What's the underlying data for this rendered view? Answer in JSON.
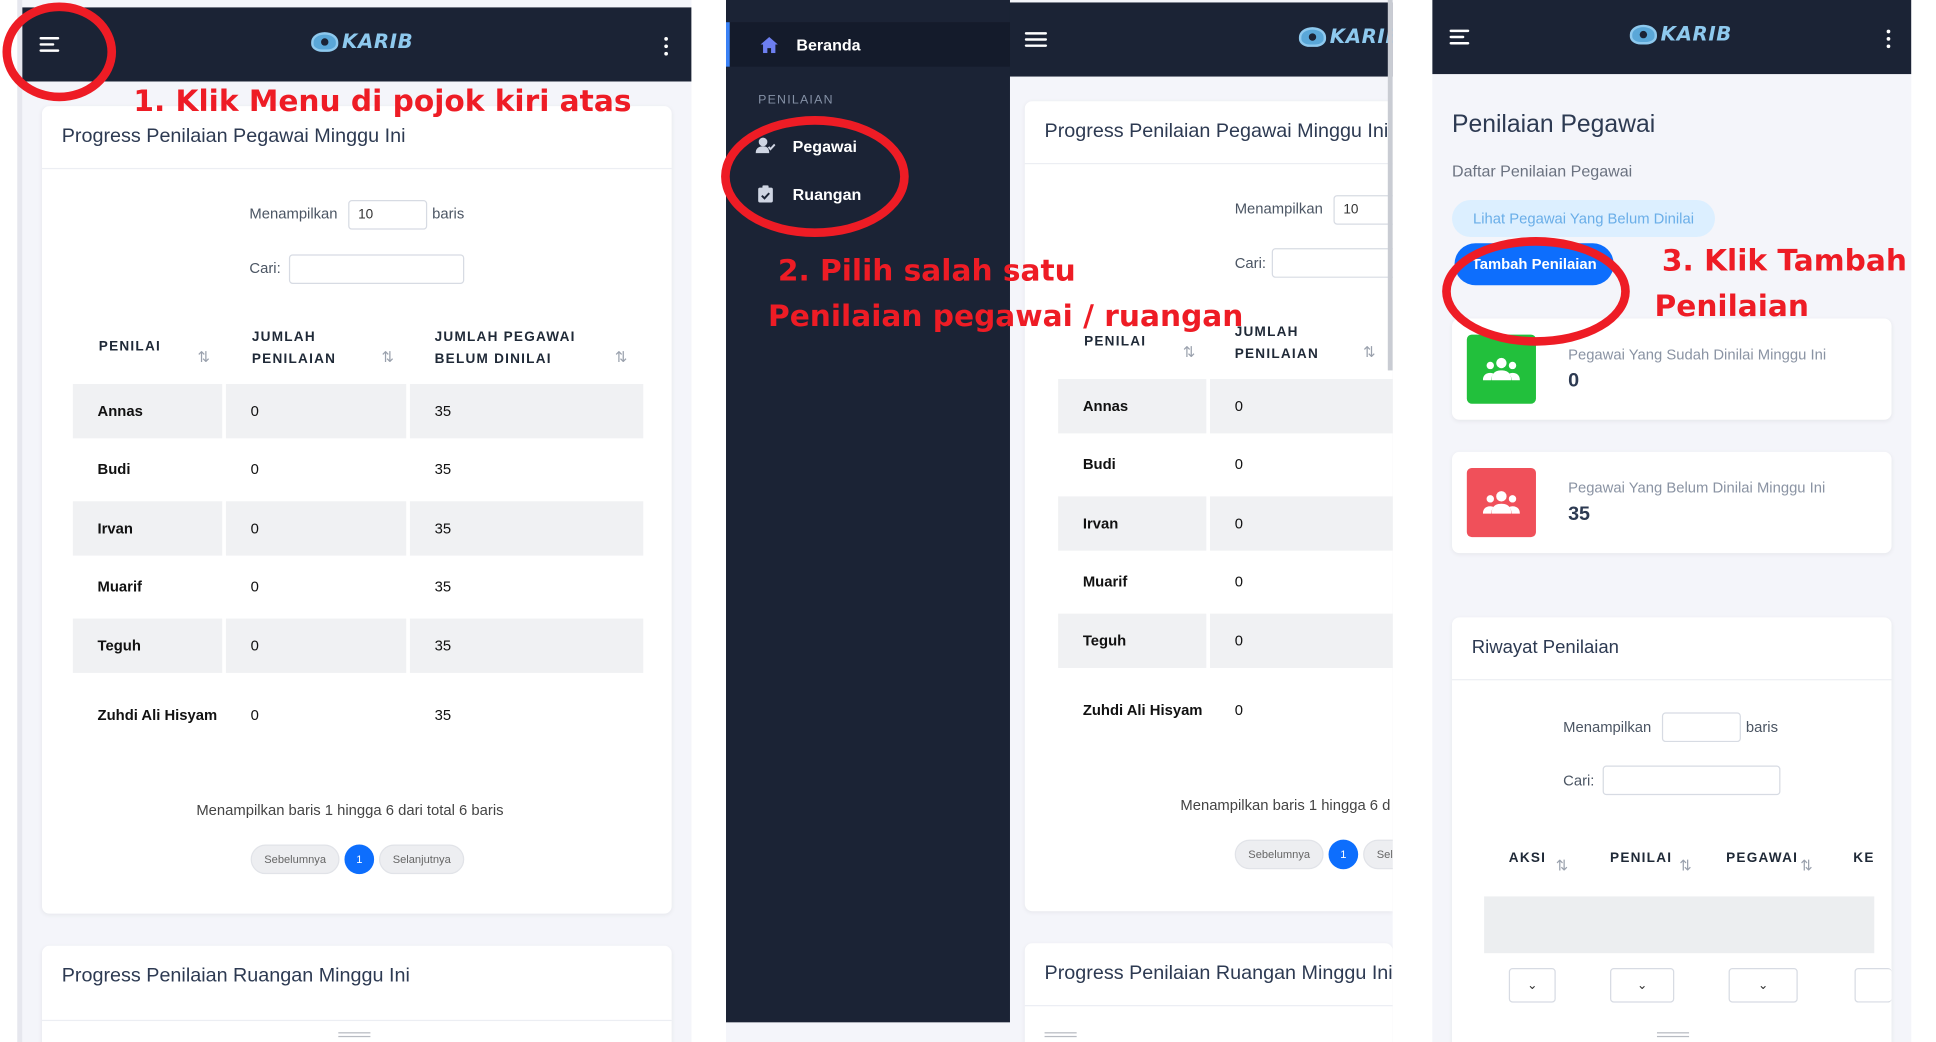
{
  "app": {
    "logo_text": "KARIB"
  },
  "annotations": {
    "step1": "1. Klik Menu di pojok kiri atas",
    "step2_line1": "2. Pilih salah satu",
    "step2_line2": "Penilaian pegawai / ruangan",
    "step3_line1": "3. Klik Tambah",
    "step3_line2": "Penilaian",
    "color": "#ee1c25"
  },
  "progress_card": {
    "title": "Progress Penilaian Pegawai Minggu Ini",
    "show_label": "Menampilkan",
    "show_value": "10",
    "rows_label": "baris",
    "search_label": "Cari:",
    "columns": [
      "PENILAI",
      "JUMLAH PENILAIAN",
      "JUMLAH PEGAWAI BELUM DINILAI"
    ],
    "rows": [
      {
        "penilai": "Annas",
        "jumlah": "0",
        "belum": "35"
      },
      {
        "penilai": "Budi",
        "jumlah": "0",
        "belum": "35"
      },
      {
        "penilai": "Irvan",
        "jumlah": "0",
        "belum": "35"
      },
      {
        "penilai": "Muarif",
        "jumlah": "0",
        "belum": "35"
      },
      {
        "penilai": "Teguh",
        "jumlah": "0",
        "belum": "35"
      },
      {
        "penilai": "Zuhdi Ali Hisyam",
        "jumlah": "0",
        "belum": "35"
      }
    ],
    "info": "Menampilkan baris 1 hingga 6 dari total 6 baris",
    "info_truncated": "Menampilkan baris 1 hingga 6 d",
    "prev": "Sebelumnya",
    "page": "1",
    "next": "Selanjutnya",
    "next_truncated": "Sel"
  },
  "ruangan_card": {
    "title": "Progress Penilaian Ruangan Minggu Ini"
  },
  "sidebar": {
    "items": [
      {
        "label": "Beranda",
        "icon": "home-icon"
      }
    ],
    "section": "PENILAIAN",
    "sub_items": [
      {
        "label": "Pegawai",
        "icon": "user-check-icon"
      },
      {
        "label": "Ruangan",
        "icon": "clipboard-check-icon"
      }
    ],
    "accent": "#3b82f6"
  },
  "penilaian_page": {
    "title": "Penilaian Pegawai",
    "subtitle": "Daftar Penilaian Pegawai",
    "lihat_button": "Lihat Pegawai Yang Belum Dinilai",
    "tambah_button": "Tambah Penilaian",
    "stats": [
      {
        "label": "Pegawai Yang Sudah Dinilai Minggu Ini",
        "value": "0",
        "color": "#22c03c"
      },
      {
        "label": "Pegawai Yang Belum Dinilai Minggu Ini",
        "value": "35",
        "color": "#f0505a"
      }
    ],
    "riwayat": {
      "title": "Riwayat Penilaian",
      "show_label": "Menampilkan",
      "rows_label": "baris",
      "search_label": "Cari:",
      "columns": [
        "AKSI",
        "PENILAI",
        "PEGAWAI",
        "KE"
      ]
    }
  }
}
